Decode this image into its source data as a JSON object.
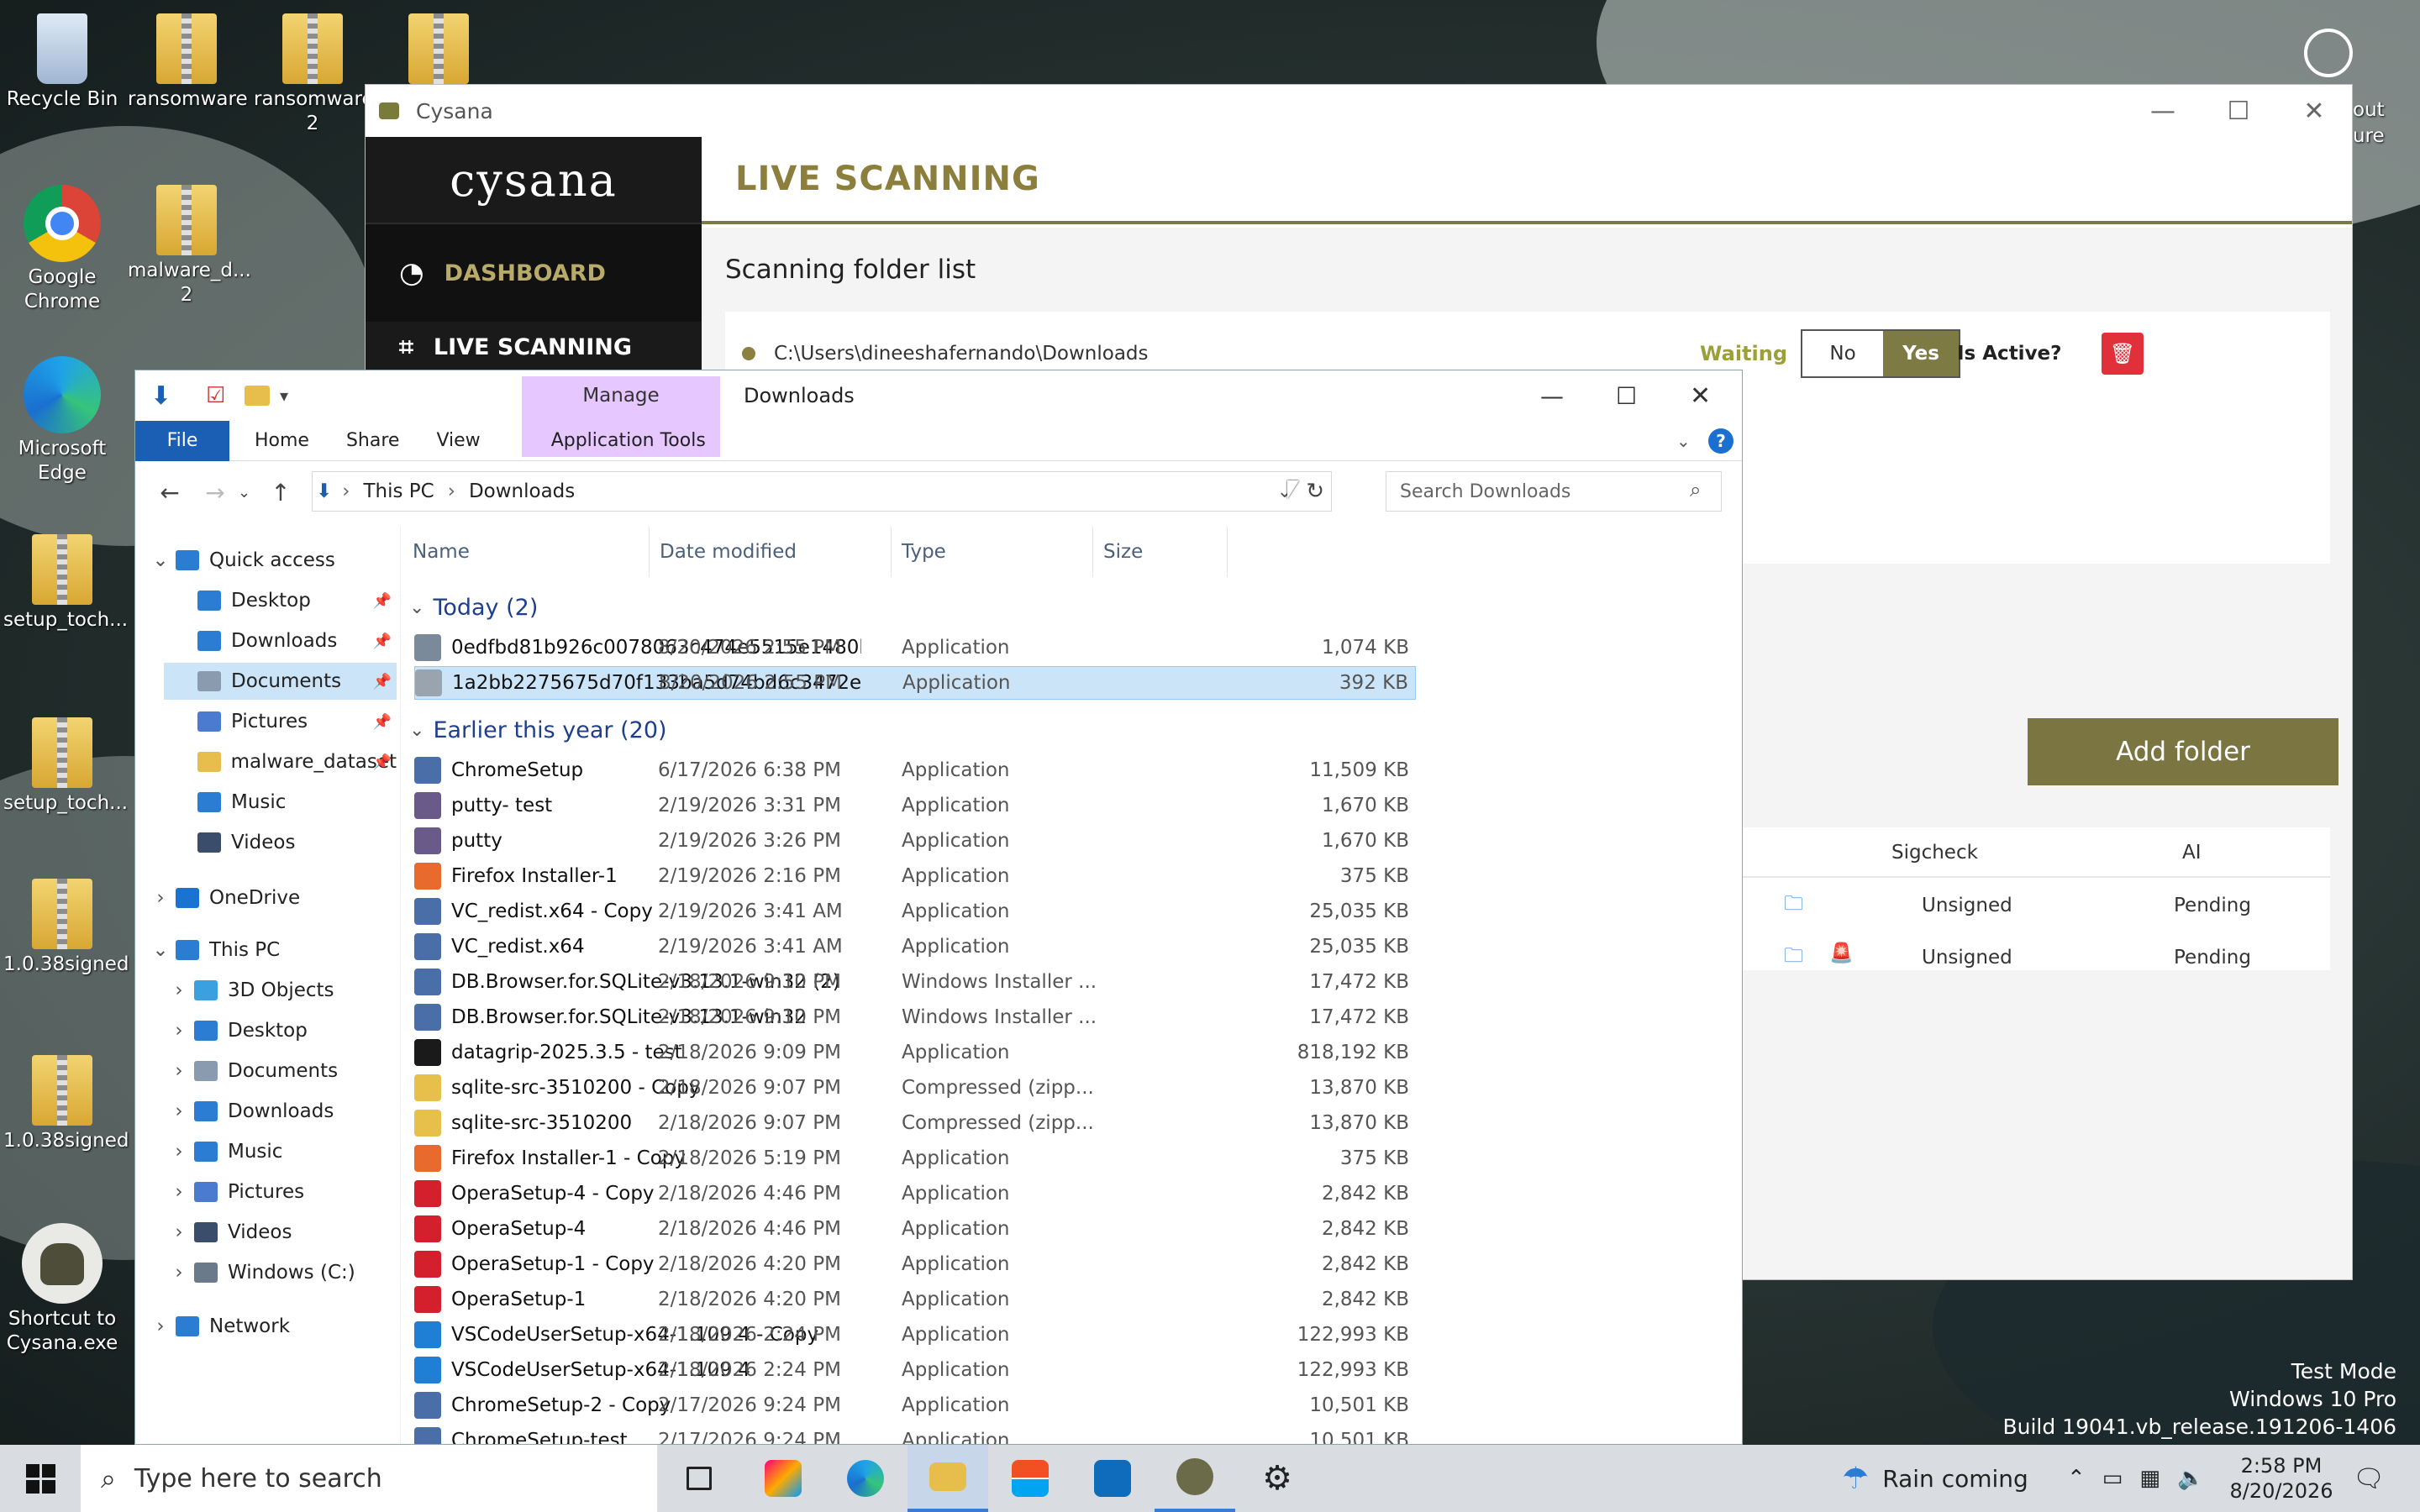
{
  "desktop": {
    "icons": [
      {
        "label": "Recycle Bin"
      },
      {
        "label": "ransomware"
      },
      {
        "label": "ransomware 2"
      },
      {
        "label": ""
      },
      {
        "label": "Google Chrome"
      },
      {
        "label": "malware_d... 2"
      },
      {
        "label": "Microsoft Edge"
      },
      {
        "label": "setup_toch..."
      },
      {
        "label": "setup_toch..."
      },
      {
        "label": "1.0.38signed"
      },
      {
        "label": "1.0.38signed"
      },
      {
        "label": "Shortcut to Cysana.exe"
      }
    ],
    "right_edge_text": [
      "out",
      "ure"
    ],
    "watermark": [
      "Test Mode",
      "Windows 10 Pro",
      "Build 19041.vb_release.191206-1406"
    ]
  },
  "cysana": {
    "title": "Cysana",
    "logo": "cysana",
    "logo_tagline": "",
    "nav": [
      {
        "label": "DASHBOARD"
      },
      {
        "label": "LIVE SCANNING"
      }
    ],
    "header": "LIVE SCANNING",
    "section": "Scanning folder list",
    "folder": {
      "path": "C:\\Users\\dineeshafernando\\Downloads",
      "status": "Waiting",
      "toggle_no": "No",
      "toggle_yes": "Yes",
      "toggle_selected": "Yes",
      "is_active": "Is Active?"
    },
    "add_folder": "Add folder",
    "table": {
      "columns": [
        "Sigcheck",
        "AI"
      ],
      "rows": [
        {
          "sigcheck": "Unsigned",
          "ai": "Pending",
          "alert": false
        },
        {
          "sigcheck": "Unsigned",
          "ai": "Pending",
          "alert": true
        }
      ]
    },
    "colors": {
      "accent": "#7b7541",
      "gold_text": "#8c7f3d",
      "danger": "#e0303a",
      "sidebar": "#1a1a1a"
    }
  },
  "explorer": {
    "title": "Downloads",
    "manage_label": "Manage",
    "tabs": [
      "File",
      "Home",
      "Share",
      "View",
      "Application Tools"
    ],
    "breadcrumb": [
      "This PC",
      "Downloads"
    ],
    "search_placeholder": "Search Downloads",
    "columns": [
      "Name",
      "Date modified",
      "Type",
      "Size"
    ],
    "tree": [
      {
        "label": "Quick access",
        "icon": "star-icon",
        "color": "#2b7cd3",
        "level": 0,
        "expanded": true
      },
      {
        "label": "Desktop",
        "icon": "desktop-icon",
        "color": "#2b7cd3",
        "level": 1,
        "pinned": true
      },
      {
        "label": "Downloads",
        "icon": "download-arrow-icon",
        "color": "#2b7cd3",
        "level": 1,
        "pinned": true
      },
      {
        "label": "Documents",
        "icon": "documents-icon",
        "color": "#8a9bb0",
        "level": 1,
        "pinned": true,
        "selected": true
      },
      {
        "label": "Pictures",
        "icon": "pictures-icon",
        "color": "#4a7bd0",
        "level": 1,
        "pinned": true
      },
      {
        "label": "malware_dataset",
        "icon": "folder-icon",
        "color": "#e7bd4c",
        "level": 1,
        "pinned": true
      },
      {
        "label": "Music",
        "icon": "music-icon",
        "color": "#2b7cd3",
        "level": 1
      },
      {
        "label": "Videos",
        "icon": "videos-icon",
        "color": "#3a4d6b",
        "level": 1
      },
      {
        "label": "OneDrive",
        "icon": "onedrive-icon",
        "color": "#1a73d0",
        "level": 0,
        "expanded": false
      },
      {
        "label": "This PC",
        "icon": "computer-icon",
        "color": "#2b7cd3",
        "level": 0,
        "expanded": true
      },
      {
        "label": "3D Objects",
        "icon": "cube-icon",
        "color": "#3aa0e0",
        "level": 1
      },
      {
        "label": "Desktop",
        "icon": "desktop-icon",
        "color": "#2b7cd3",
        "level": 1
      },
      {
        "label": "Documents",
        "icon": "documents-icon",
        "color": "#8a9bb0",
        "level": 1
      },
      {
        "label": "Downloads",
        "icon": "download-arrow-icon",
        "color": "#2b7cd3",
        "level": 1
      },
      {
        "label": "Music",
        "icon": "music-icon",
        "color": "#2b7cd3",
        "level": 1
      },
      {
        "label": "Pictures",
        "icon": "pictures-icon",
        "color": "#4a7bd0",
        "level": 1
      },
      {
        "label": "Videos",
        "icon": "videos-icon",
        "color": "#3a4d6b",
        "level": 1
      },
      {
        "label": "Windows (C:)",
        "icon": "drive-icon",
        "color": "#6b7a8a",
        "level": 1
      },
      {
        "label": "Network",
        "icon": "network-icon",
        "color": "#2b7cd3",
        "level": 0,
        "expanded": false
      }
    ],
    "groups": [
      {
        "label": "Today (2)",
        "files": [
          {
            "name": "0edfbd81b926c0078063c474e5515e1480b...",
            "date": "8/20/2026 2:55 PM",
            "type": "Application",
            "size": "1,074 KB",
            "icon": "generic-exe-icon",
            "color": "#7a8a9a"
          },
          {
            "name": "1a2bb2275675d70f133ba5d74bd6c3472eb...",
            "date": "8/20/2026 2:55 PM",
            "type": "Application",
            "size": "392 KB",
            "icon": "generic-exe-icon",
            "color": "#9aa4ae",
            "selected": true
          }
        ]
      },
      {
        "label": "Earlier this year (20)",
        "files": [
          {
            "name": "ChromeSetup",
            "date": "6/17/2026 6:38 PM",
            "type": "Application",
            "size": "11,509 KB",
            "icon": "setup-icon",
            "color": "#4a6fa8"
          },
          {
            "name": "putty- test",
            "date": "2/19/2026 3:31 PM",
            "type": "Application",
            "size": "1,670 KB",
            "icon": "putty-icon",
            "color": "#6a5a8a"
          },
          {
            "name": "putty",
            "date": "2/19/2026 3:26 PM",
            "type": "Application",
            "size": "1,670 KB",
            "icon": "putty-icon",
            "color": "#6a5a8a"
          },
          {
            "name": "Firefox Installer-1",
            "date": "2/19/2026 2:16 PM",
            "type": "Application",
            "size": "375 KB",
            "icon": "firefox-icon",
            "color": "#e86a2c"
          },
          {
            "name": "VC_redist.x64 - Copy",
            "date": "2/19/2026 3:41 AM",
            "type": "Application",
            "size": "25,035 KB",
            "icon": "installer-icon",
            "color": "#4a6fa8"
          },
          {
            "name": "VC_redist.x64",
            "date": "2/19/2026 3:41 AM",
            "type": "Application",
            "size": "25,035 KB",
            "icon": "installer-icon",
            "color": "#4a6fa8"
          },
          {
            "name": "DB.Browser.for.SQLite-v3.13.1-win32 (2)",
            "date": "2/18/2026 9:10 PM",
            "type": "Windows Installer ...",
            "size": "17,472 KB",
            "icon": "msi-icon",
            "color": "#4a6fa8"
          },
          {
            "name": "DB.Browser.for.SQLite-v3.13.1-win32",
            "date": "2/18/2026 9:10 PM",
            "type": "Windows Installer ...",
            "size": "17,472 KB",
            "icon": "msi-icon",
            "color": "#4a6fa8"
          },
          {
            "name": "datagrip-2025.3.5 - test",
            "date": "2/18/2026 9:09 PM",
            "type": "Application",
            "size": "818,192 KB",
            "icon": "datagrip-icon",
            "color": "#1a1a1a"
          },
          {
            "name": "sqlite-src-3510200 - Copy",
            "date": "2/18/2026 9:07 PM",
            "type": "Compressed (zipp...",
            "size": "13,870 KB",
            "icon": "zip-icon",
            "color": "#e7c04c"
          },
          {
            "name": "sqlite-src-3510200",
            "date": "2/18/2026 9:07 PM",
            "type": "Compressed (zipp...",
            "size": "13,870 KB",
            "icon": "zip-icon",
            "color": "#e7c04c"
          },
          {
            "name": "Firefox Installer-1 - Copy",
            "date": "2/18/2026 5:19 PM",
            "type": "Application",
            "size": "375 KB",
            "icon": "firefox-icon",
            "color": "#e86a2c"
          },
          {
            "name": "OperaSetup-4 - Copy",
            "date": "2/18/2026 4:46 PM",
            "type": "Application",
            "size": "2,842 KB",
            "icon": "opera-icon",
            "color": "#d4202c"
          },
          {
            "name": "OperaSetup-4",
            "date": "2/18/2026 4:46 PM",
            "type": "Application",
            "size": "2,842 KB",
            "icon": "opera-icon",
            "color": "#d4202c"
          },
          {
            "name": "OperaSetup-1 - Copy",
            "date": "2/18/2026 4:20 PM",
            "type": "Application",
            "size": "2,842 KB",
            "icon": "opera-icon",
            "color": "#d4202c"
          },
          {
            "name": "OperaSetup-1",
            "date": "2/18/2026 4:20 PM",
            "type": "Application",
            "size": "2,842 KB",
            "icon": "opera-icon",
            "color": "#d4202c"
          },
          {
            "name": "VSCodeUserSetup-x64-1.109.4 - Copy",
            "date": "2/18/2026 2:24 PM",
            "type": "Application",
            "size": "122,993 KB",
            "icon": "vscode-icon",
            "color": "#1e7fd4"
          },
          {
            "name": "VSCodeUserSetup-x64-1.109.4",
            "date": "2/18/2026 2:24 PM",
            "type": "Application",
            "size": "122,993 KB",
            "icon": "vscode-icon",
            "color": "#1e7fd4"
          },
          {
            "name": "ChromeSetup-2 - Copy",
            "date": "2/17/2026 9:24 PM",
            "type": "Application",
            "size": "10,501 KB",
            "icon": "setup-icon",
            "color": "#4a6fa8"
          },
          {
            "name": "ChromeSetup-test",
            "date": "2/17/2026 9:24 PM",
            "type": "Application",
            "size": "10,501 KB",
            "icon": "setup-icon",
            "color": "#4a6fa8"
          }
        ]
      }
    ]
  },
  "taskbar": {
    "search_placeholder": "Type here to search",
    "weather": "Rain coming",
    "time": "2:58 PM",
    "date": "8/20/2026",
    "apps": [
      "task-view-icon",
      "copilot-icon",
      "edge-icon",
      "file-explorer-icon",
      "store-icon",
      "outlook-icon",
      "cysana-icon",
      "settings-icon"
    ]
  }
}
